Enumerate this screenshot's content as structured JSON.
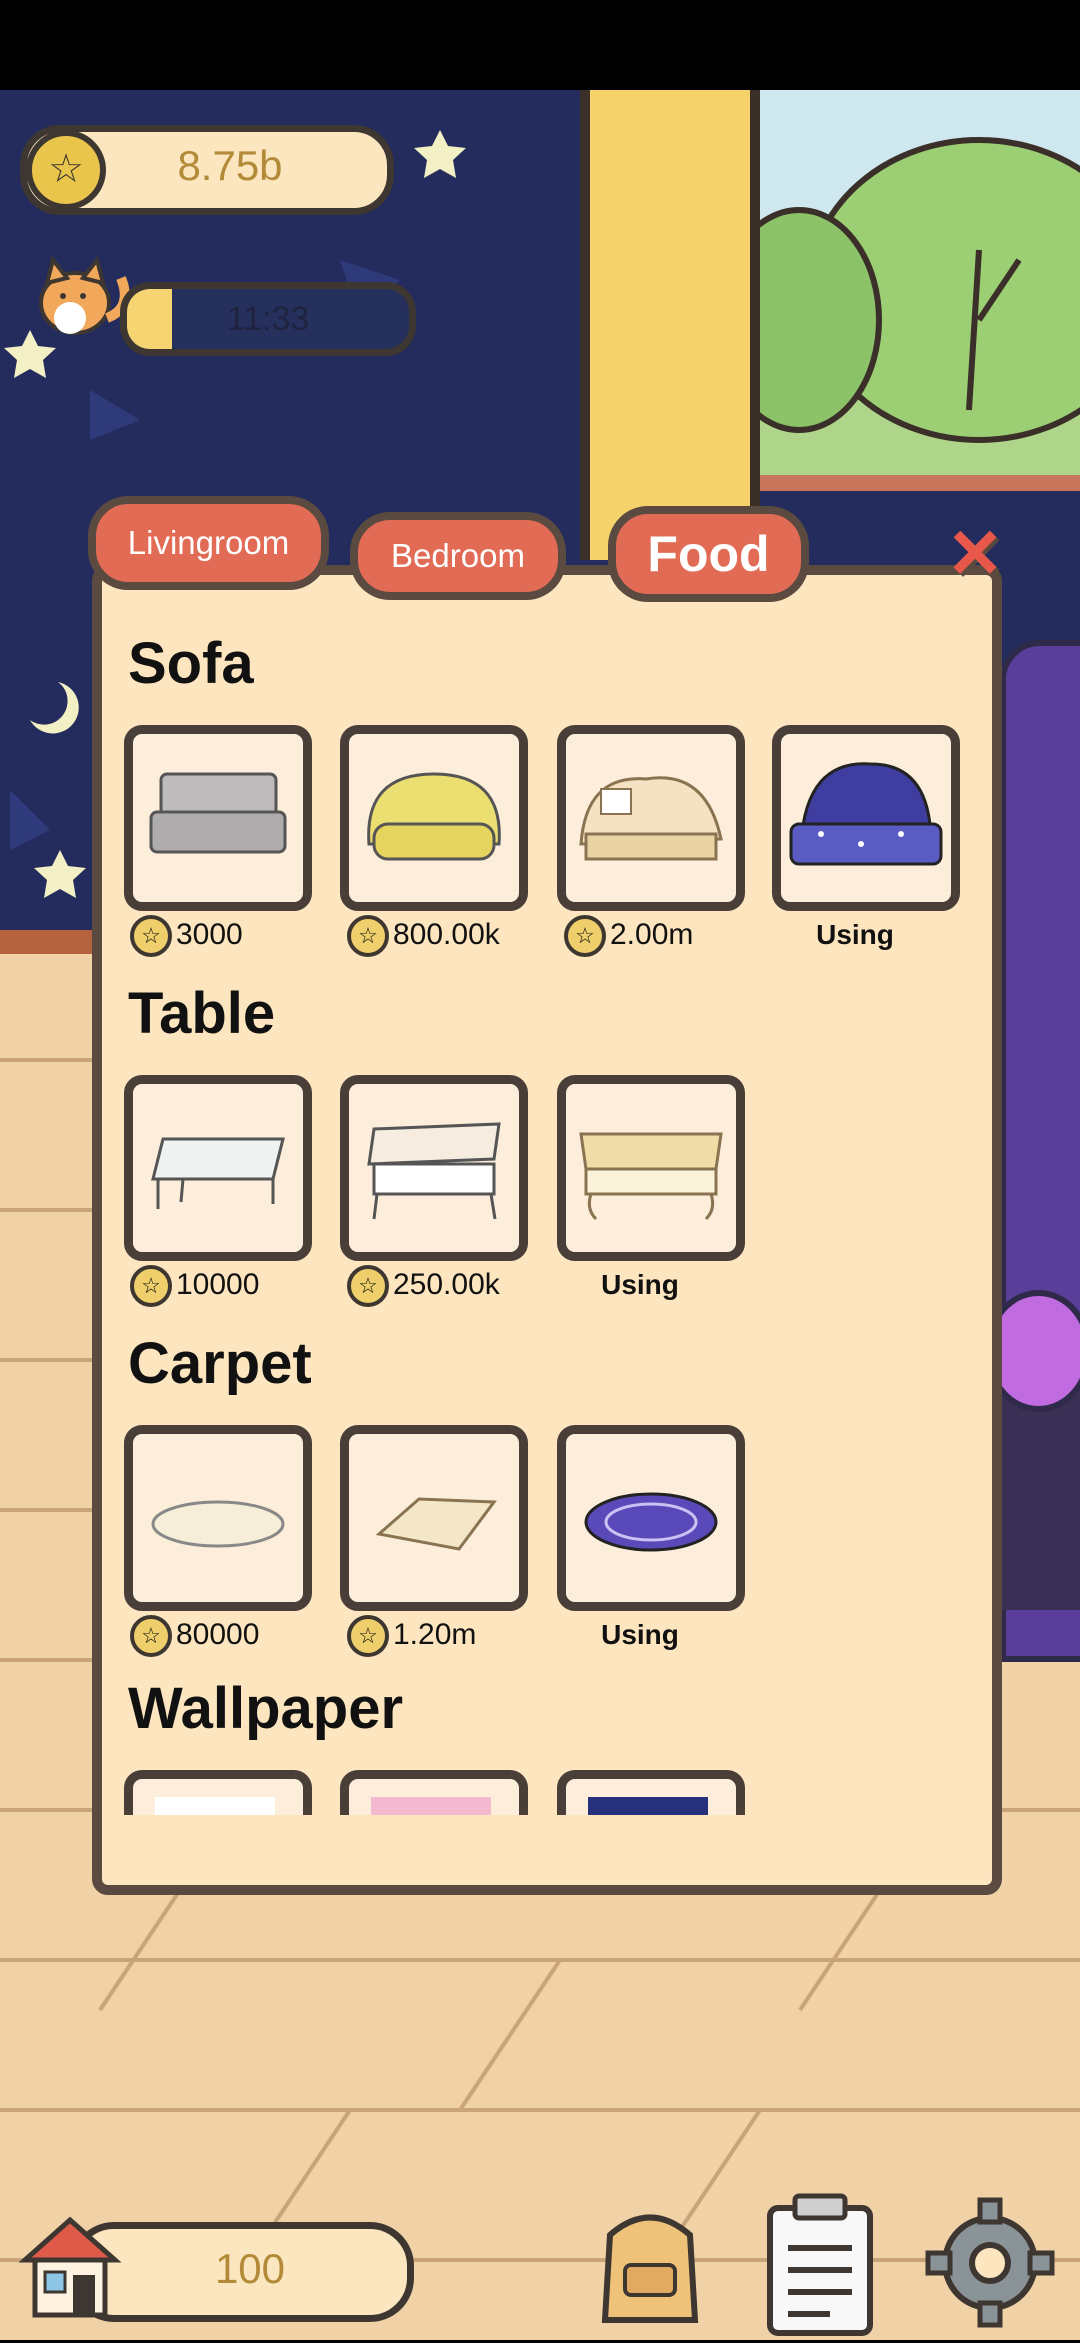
{
  "hud": {
    "coins": "8.75b",
    "timer": "11:33",
    "timer_progress": 0.16,
    "houses": "100"
  },
  "tabs": [
    {
      "label": "Livingroom"
    },
    {
      "label": "Bedroom"
    },
    {
      "label": "Food"
    }
  ],
  "close_icon": "×",
  "sections": {
    "sofa": {
      "title": "Sofa",
      "items": [
        {
          "price": "3000"
        },
        {
          "price": "800.00k"
        },
        {
          "price": "2.00m"
        },
        {
          "status": "Using"
        }
      ]
    },
    "table": {
      "title": "Table",
      "items": [
        {
          "price": "10000"
        },
        {
          "price": "250.00k"
        },
        {
          "status": "Using"
        }
      ]
    },
    "carpet": {
      "title": "Carpet",
      "items": [
        {
          "price": "80000"
        },
        {
          "price": "1.20m"
        },
        {
          "status": "Using"
        }
      ]
    },
    "wallpaper": {
      "title": "Wallpaper"
    }
  },
  "icons": {
    "coin": "star-coin-icon",
    "star": "☆",
    "cat": "cat-icon",
    "house": "house-icon",
    "bag": "backpack-icon",
    "clipboard": "clipboard-icon",
    "settings": "gear-icon"
  },
  "colors": {
    "panel_bg": "#fde6bf",
    "tab_bg": "#e26b55",
    "close": "#e8584a",
    "wall": "#232c5c",
    "floor": "#f0d2a6"
  }
}
